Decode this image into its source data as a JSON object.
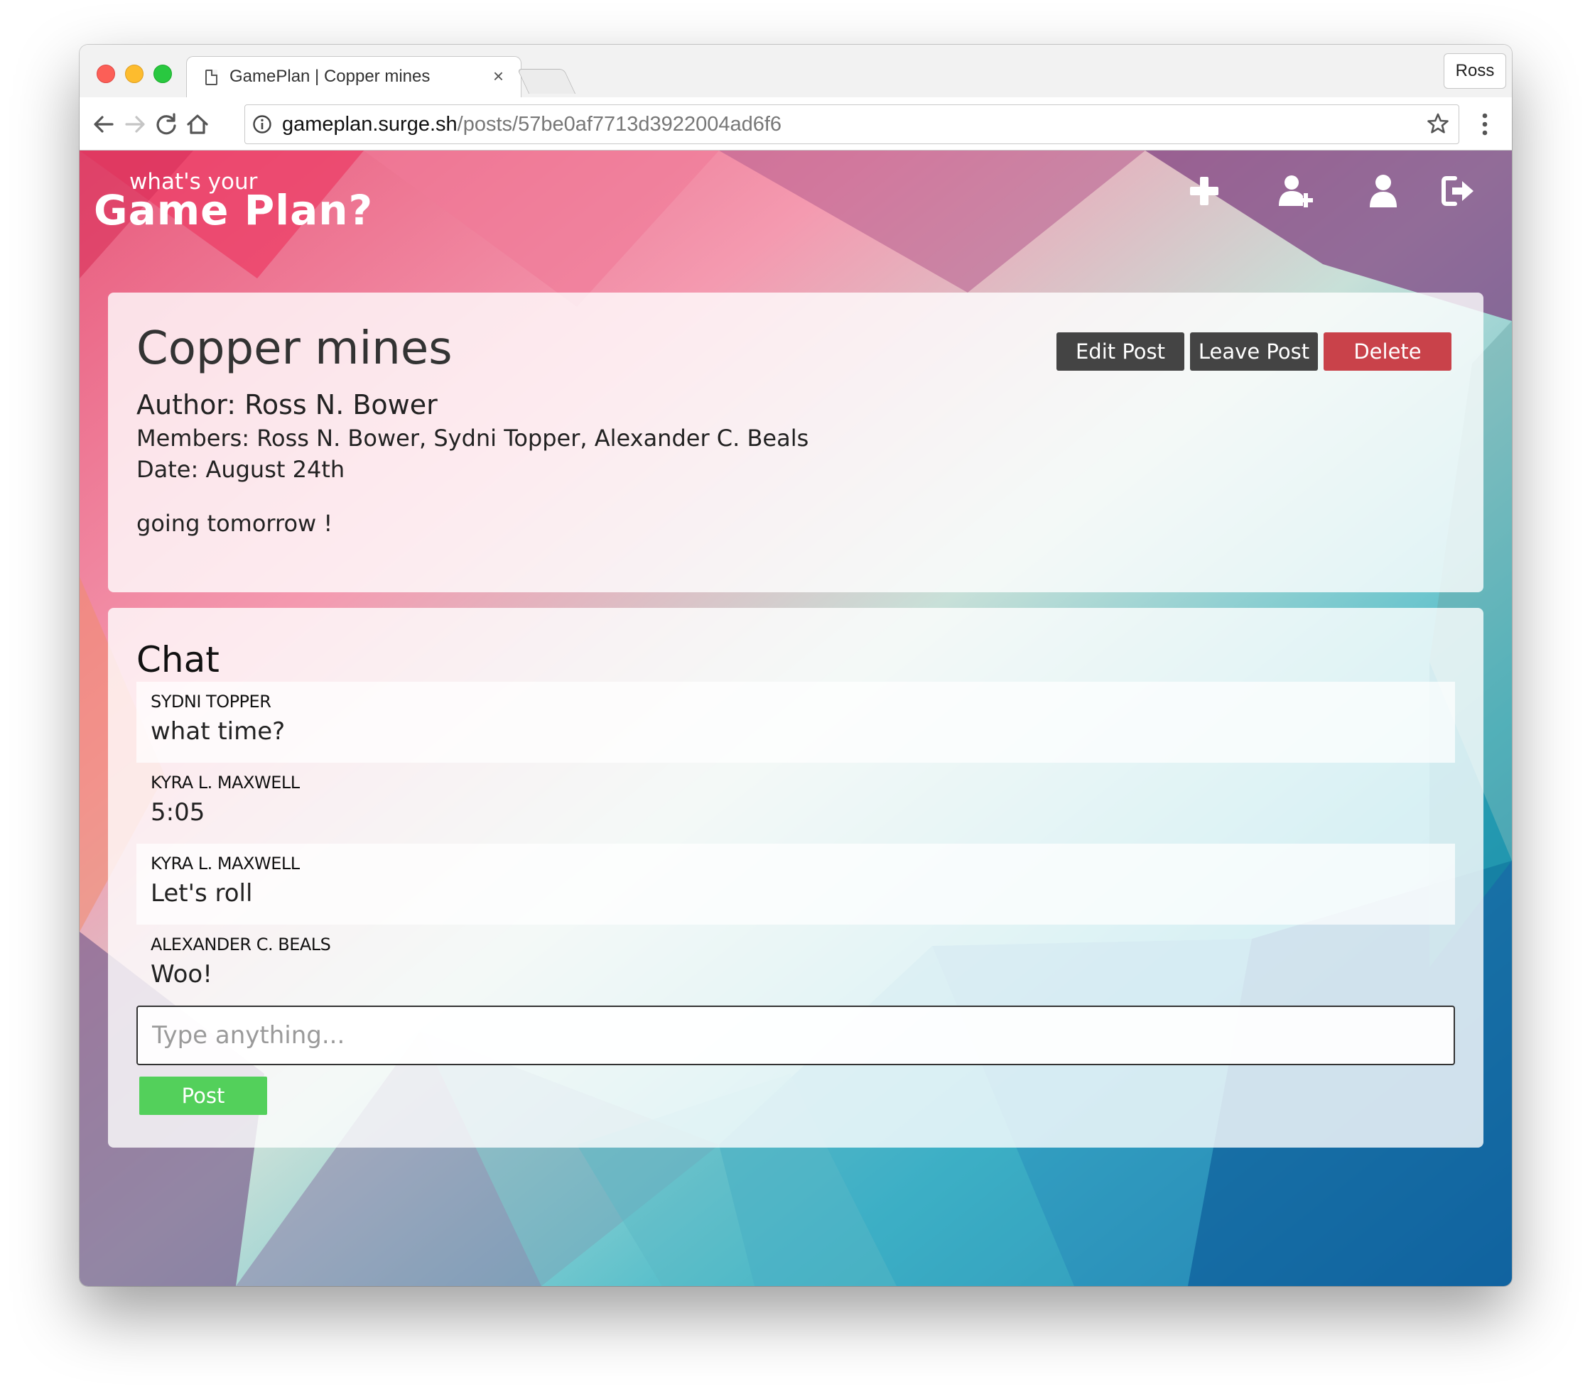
{
  "browser": {
    "tab_title": "GamePlan | Copper mines",
    "tab_close": "×",
    "profile_name": "Ross",
    "url_host": "gameplan.surge.sh",
    "url_path": "/posts/57be0af7713d3922004ad6f6"
  },
  "header": {
    "logo_small": "what's your",
    "logo_big": "Game Plan?",
    "icons": [
      "plus-icon",
      "user-plus-icon",
      "user-icon",
      "sign-out-icon"
    ]
  },
  "post": {
    "title": "Copper mines",
    "author": "Author: Ross N. Bower",
    "members": "Members: Ross N. Bower, Sydni Topper, Alexander C. Beals",
    "date": "Date: August 24th",
    "description": "going tomorrow !",
    "edit_label": "Edit Post",
    "leave_label": "Leave Post",
    "delete_label": "Delete"
  },
  "chat": {
    "title": "Chat",
    "messages": [
      {
        "author": "SYDNI TOPPER",
        "text": "what time?"
      },
      {
        "author": "KYRA L. MAXWELL",
        "text": "5:05"
      },
      {
        "author": "KYRA L. MAXWELL",
        "text": "Let's roll"
      },
      {
        "author": "ALEXANDER C. BEALS",
        "text": "Woo!"
      }
    ],
    "input_placeholder": "Type anything...",
    "post_label": "Post"
  },
  "colors": {
    "delete_button": "#c9424a",
    "dark_button": "#444444",
    "post_button": "#53d05b"
  }
}
